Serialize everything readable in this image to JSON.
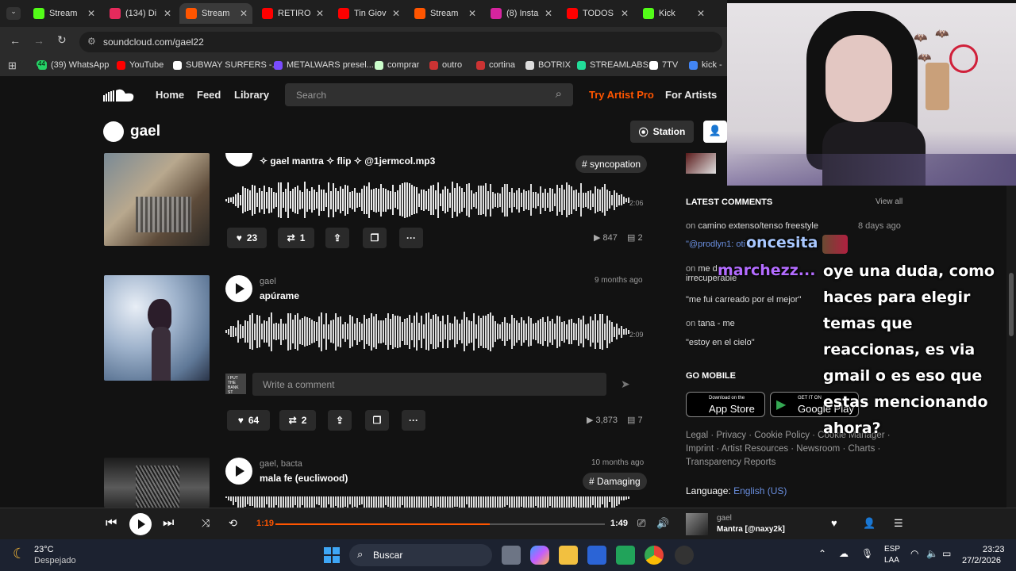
{
  "tabs": [
    {
      "label": "Stream",
      "color": "#53fc18"
    },
    {
      "label": "(134) Di",
      "color": "#e62a5c"
    },
    {
      "label": "Stream",
      "color": "#ff5500"
    },
    {
      "label": "RETIRO",
      "color": "#ff0000"
    },
    {
      "label": "Tin Giov",
      "color": "#ff0000"
    },
    {
      "label": "Stream",
      "color": "#ff5500"
    },
    {
      "label": "(8) Insta",
      "color": "#d6249f"
    },
    {
      "label": "TODOS",
      "color": "#ff0000"
    },
    {
      "label": "Kick",
      "color": "#53fc18"
    }
  ],
  "browser": {
    "url": "soundcloud.com/gael22"
  },
  "bookmarks": [
    "(39) WhatsApp",
    "YouTube",
    "SUBWAY SURFERS -...",
    "METALWARS presel...",
    "comprar",
    "outro",
    "cortina",
    "BOTRIX",
    "STREAMLABS",
    "7TV",
    "kick -"
  ],
  "bookmark_badge": "44",
  "sc": {
    "nav": [
      "Home",
      "Feed",
      "Library"
    ],
    "search_placeholder": "Search",
    "try_pro": "Try Artist Pro",
    "for_artists": "For Artists",
    "profile_name": "gael",
    "station": "Station"
  },
  "tracks": [
    {
      "title": "✧ gael mantra ✧ flip ✧ @1jermcol.mp3",
      "tag": "# syncopation",
      "duration": "2:06",
      "likes": "23",
      "reposts": "1",
      "plays": "847",
      "comments": "2"
    },
    {
      "artist": "gael",
      "title": "apúrame",
      "time": "9 months ago",
      "duration": "2:09",
      "likes": "64",
      "reposts": "2",
      "plays": "3,873",
      "comments": "7",
      "comment_placeholder": "Write a comment",
      "avatar_text": "I PUT THE BANK ST"
    },
    {
      "artist": "gael, bacta",
      "title": "mala fe (eucliwood)",
      "time": "10 months ago",
      "tag": "# Damaging"
    }
  ],
  "sidebar": {
    "latest_comments": "LATEST COMMENTS",
    "view_all": "View all",
    "comments": [
      {
        "on": "on",
        "track": "camino extenso/tenso freestyle",
        "time": "8 days ago",
        "text": "\"@prodlyn1: oti"
      },
      {
        "on": "on",
        "track": "me d",
        "track2": "irrecuperable",
        "text": "\"me fui carreado por el mejor\""
      },
      {
        "on": "on",
        "track": "tana - me",
        "text": "\"estoy en el cielo\""
      }
    ],
    "go_mobile": "GO MOBILE",
    "app_store_small": "Download on the",
    "app_store": "App Store",
    "google_small": "GET IT ON",
    "google_play": "Google Play",
    "footer_links": "Legal · Privacy · Cookie Policy · Cookie Manager · Imprint · Artist Resources · Newsroom · Charts · Transparency Reports",
    "language_label": "Language:",
    "language": "English (US)"
  },
  "player": {
    "elapsed": "1:19",
    "total": "1:49",
    "progress": 0.65,
    "artist": "gael",
    "track": "Mantra [@naxy2k]"
  },
  "overlay": {
    "user1": "oncesita",
    "user2": "marchezz...",
    "message": "oye una duda, como haces para elegir temas que reaccionas, es via gmail o es eso que estas mencionando ahora?"
  },
  "taskbar": {
    "temp": "23°C",
    "weather": "Despejado",
    "search": "Buscar",
    "lang1": "ESP",
    "lang2": "LAA",
    "time": "23:23",
    "date": "27/2/2026"
  }
}
